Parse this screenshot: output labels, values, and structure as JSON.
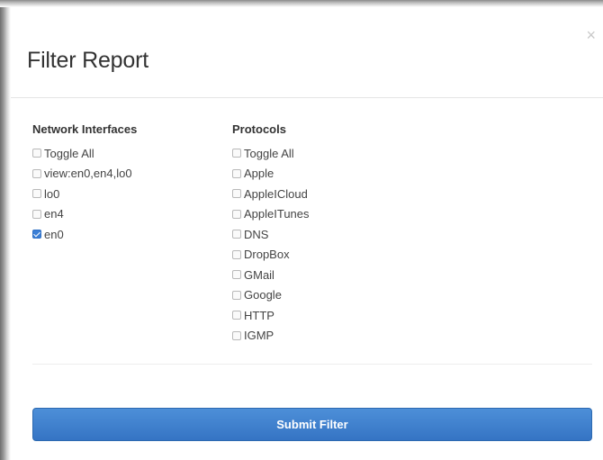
{
  "modal": {
    "title": "Filter Report",
    "close_glyph": "×"
  },
  "network": {
    "heading": "Network Interfaces",
    "options": [
      {
        "label": "Toggle All",
        "checked": false
      },
      {
        "label": "view:en0,en4,lo0",
        "checked": false
      },
      {
        "label": "lo0",
        "checked": false
      },
      {
        "label": "en4",
        "checked": false
      },
      {
        "label": "en0",
        "checked": true
      }
    ]
  },
  "protocols": {
    "heading": "Protocols",
    "options": [
      {
        "label": "Toggle All",
        "checked": false
      },
      {
        "label": "Apple",
        "checked": false
      },
      {
        "label": "AppleICloud",
        "checked": false
      },
      {
        "label": "AppleITunes",
        "checked": false
      },
      {
        "label": "DNS",
        "checked": false
      },
      {
        "label": "DropBox",
        "checked": false
      },
      {
        "label": "GMail",
        "checked": false
      },
      {
        "label": "Google",
        "checked": false
      },
      {
        "label": "HTTP",
        "checked": false
      },
      {
        "label": "IGMP",
        "checked": false
      }
    ]
  },
  "submit": {
    "label": "Submit Filter"
  },
  "colors": {
    "button": "#3a7bcb",
    "checkbox_checked": "#3b7fd6",
    "title": "#333333"
  }
}
